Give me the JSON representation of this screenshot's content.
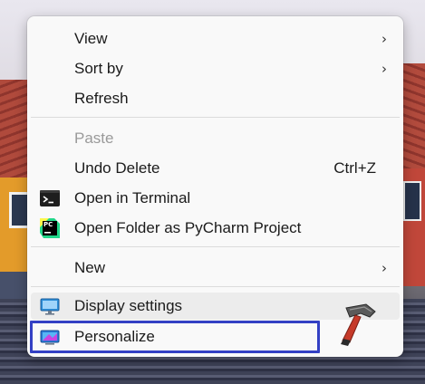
{
  "menu": {
    "items": [
      {
        "label": "View",
        "submenu": true
      },
      {
        "label": "Sort by",
        "submenu": true
      },
      {
        "label": "Refresh"
      },
      {
        "label": "Paste",
        "disabled": true
      },
      {
        "label": "Undo Delete",
        "shortcut": "Ctrl+Z"
      },
      {
        "label": "Open in Terminal",
        "icon": "terminal-icon"
      },
      {
        "label": "Open Folder as PyCharm Project",
        "icon": "pycharm-icon"
      },
      {
        "label": "New",
        "submenu": true
      },
      {
        "label": "Display settings",
        "icon": "display-icon",
        "hovered": true
      },
      {
        "label": "Personalize",
        "icon": "personalize-icon",
        "highlighted": true
      }
    ],
    "chevron": "›"
  },
  "icons": {
    "pycharm_text": "PC",
    "watermark": "hammer-logo-icon"
  },
  "colors": {
    "highlight_box": "#3340c4",
    "menu_bg": "#f9f9f9",
    "disabled_text": "#9a9a9a"
  }
}
